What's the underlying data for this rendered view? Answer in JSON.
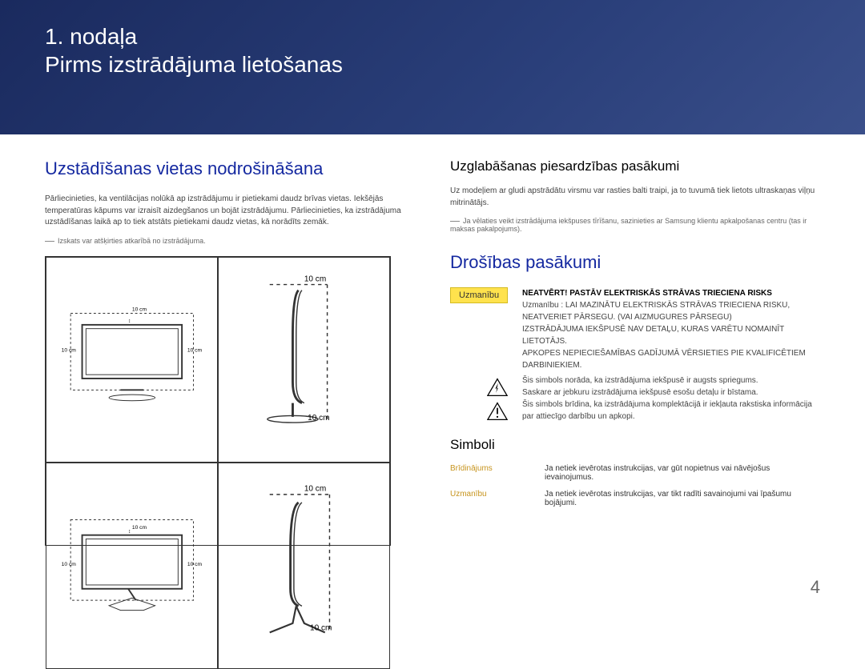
{
  "header": {
    "chapter": "1. nodaļa",
    "title": "Pirms izstrādājuma lietošanas"
  },
  "left": {
    "h2": "Uzstādīšanas vietas nodrošināšana",
    "p1": "Pārliecinieties, ka ventilācijas nolūkā ap izstrādājumu ir pietiekami daudz brīvas vietas. Iekšējās temperatūras kāpums var izraisīt aizdegšanos un bojāt izstrādājumu. Pārliecinieties, ka izstrādājuma uzstādīšanas laikā ap to tiek atstāts pietiekami daudz vietas, kā norādīts zemāk.",
    "note": "Izskats var atšķirties atkarībā no izstrādājuma.",
    "dist": "10 cm"
  },
  "right": {
    "h3a": "Uzglabāšanas piesardzības pasākumi",
    "p1": "Uz modeļiem ar gludi apstrādātu virsmu var rasties balti traipi, ja to tuvumā tiek lietots ultraskaņas viļņu mitrinātājs.",
    "note": "Ja vēlaties veikt izstrādājuma iekšpuses tīrīšanu, sazinieties ar Samsung klientu apkalpošanas centru (tas ir maksas pakalpojums).",
    "h2": "Drošības pasākumi",
    "badge1": "Uzmanību",
    "warn_title": "NEATVĒRT! PASTĀV ELEKTRISKĀS STRĀVAS TRIECIENA RISKS",
    "warn1": "Uzmanību : LAI MAZINĀTU ELEKTRISKĀS STRĀVAS TRIECIENA RISKU, NEATVERIET PĀRSEGU. (VAI AIZMUGURES PĀRSEGU)",
    "warn2": "IZSTRĀDĀJUMA IEKŠPUSĒ NAV DETAĻU, KURAS VARĒTU NOMAINĪT LIETOTĀJS.",
    "warn3": "APKOPES NEPIECIEŠAMĪBAS GADĪJUMĀ VĒRSIETIES PIE KVALIFICĒTIEM DARBINIEKIEM.",
    "warn4": "Šis simbols norāda, ka izstrādājuma iekšpusē ir augsts spriegums.",
    "warn5": "Saskare ar jebkuru izstrādājuma iekšpusē esošu detaļu ir bīstama.",
    "warn6": "Šis simbols brīdina, ka izstrādājuma komplektācijā ir iekļauta rakstiska informācija par attiecīgo darbību un apkopi.",
    "h3b": "Simboli",
    "sym1_label": "Brīdinājums",
    "sym1_text": "Ja netiek ievērotas instrukcijas, var gūt nopietnus vai nāvējošus ievainojumus.",
    "sym2_label": "Uzmanību",
    "sym2_text": "Ja netiek ievērotas instrukcijas, var tikt radīti savainojumi vai īpašumu bojājumi."
  },
  "page": "4"
}
